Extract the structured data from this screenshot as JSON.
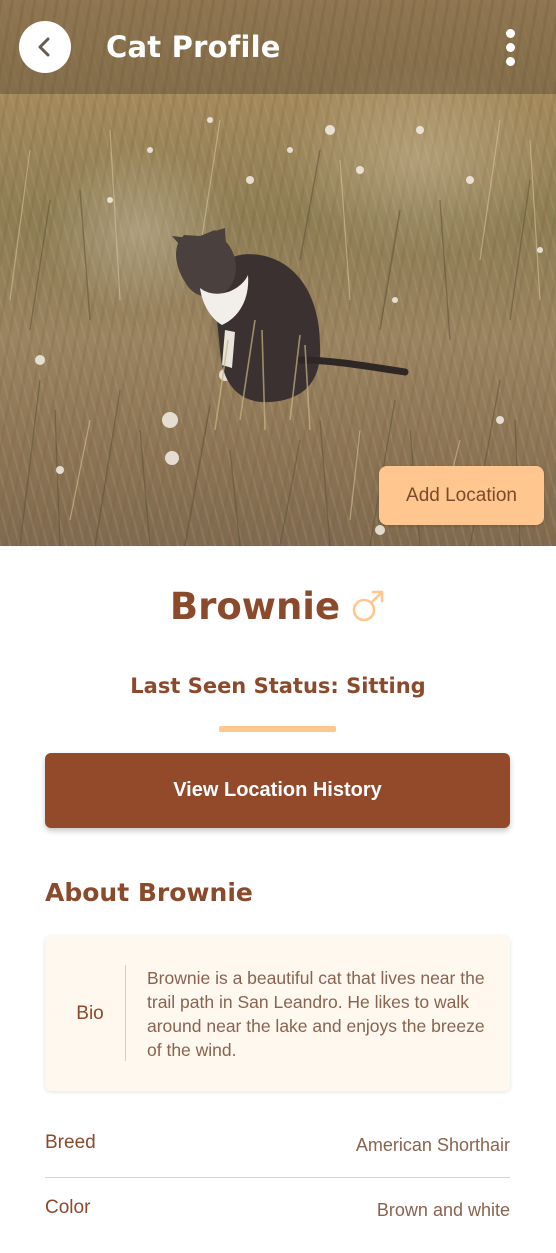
{
  "header": {
    "title": "Cat Profile",
    "back_icon": "chevron-left-icon",
    "menu_icon": "more-vertical-icon"
  },
  "hero": {
    "image_subject": "grey and white cat sitting in a field of dry grass",
    "add_location_label": "Add Location"
  },
  "profile": {
    "name": "Brownie",
    "gender_icon": "male-icon",
    "status_text": "Last Seen Status: Sitting",
    "history_button_label": "View Location History"
  },
  "about": {
    "title": "About Brownie",
    "bio_label": "Bio",
    "bio_text": "Brownie is a beautiful cat that lives near the trail path in San Leandro. He likes to walk around near the lake and enjoys the breeze of the wind."
  },
  "details": [
    {
      "label": "Breed",
      "value": "American Shorthair"
    },
    {
      "label": "Color",
      "value": "Brown and white"
    }
  ],
  "colors": {
    "accent": "#ffc690",
    "brand_brown": "#924a2b",
    "text_brown": "#8b4a2b",
    "bio_bg": "#fff8ef"
  }
}
